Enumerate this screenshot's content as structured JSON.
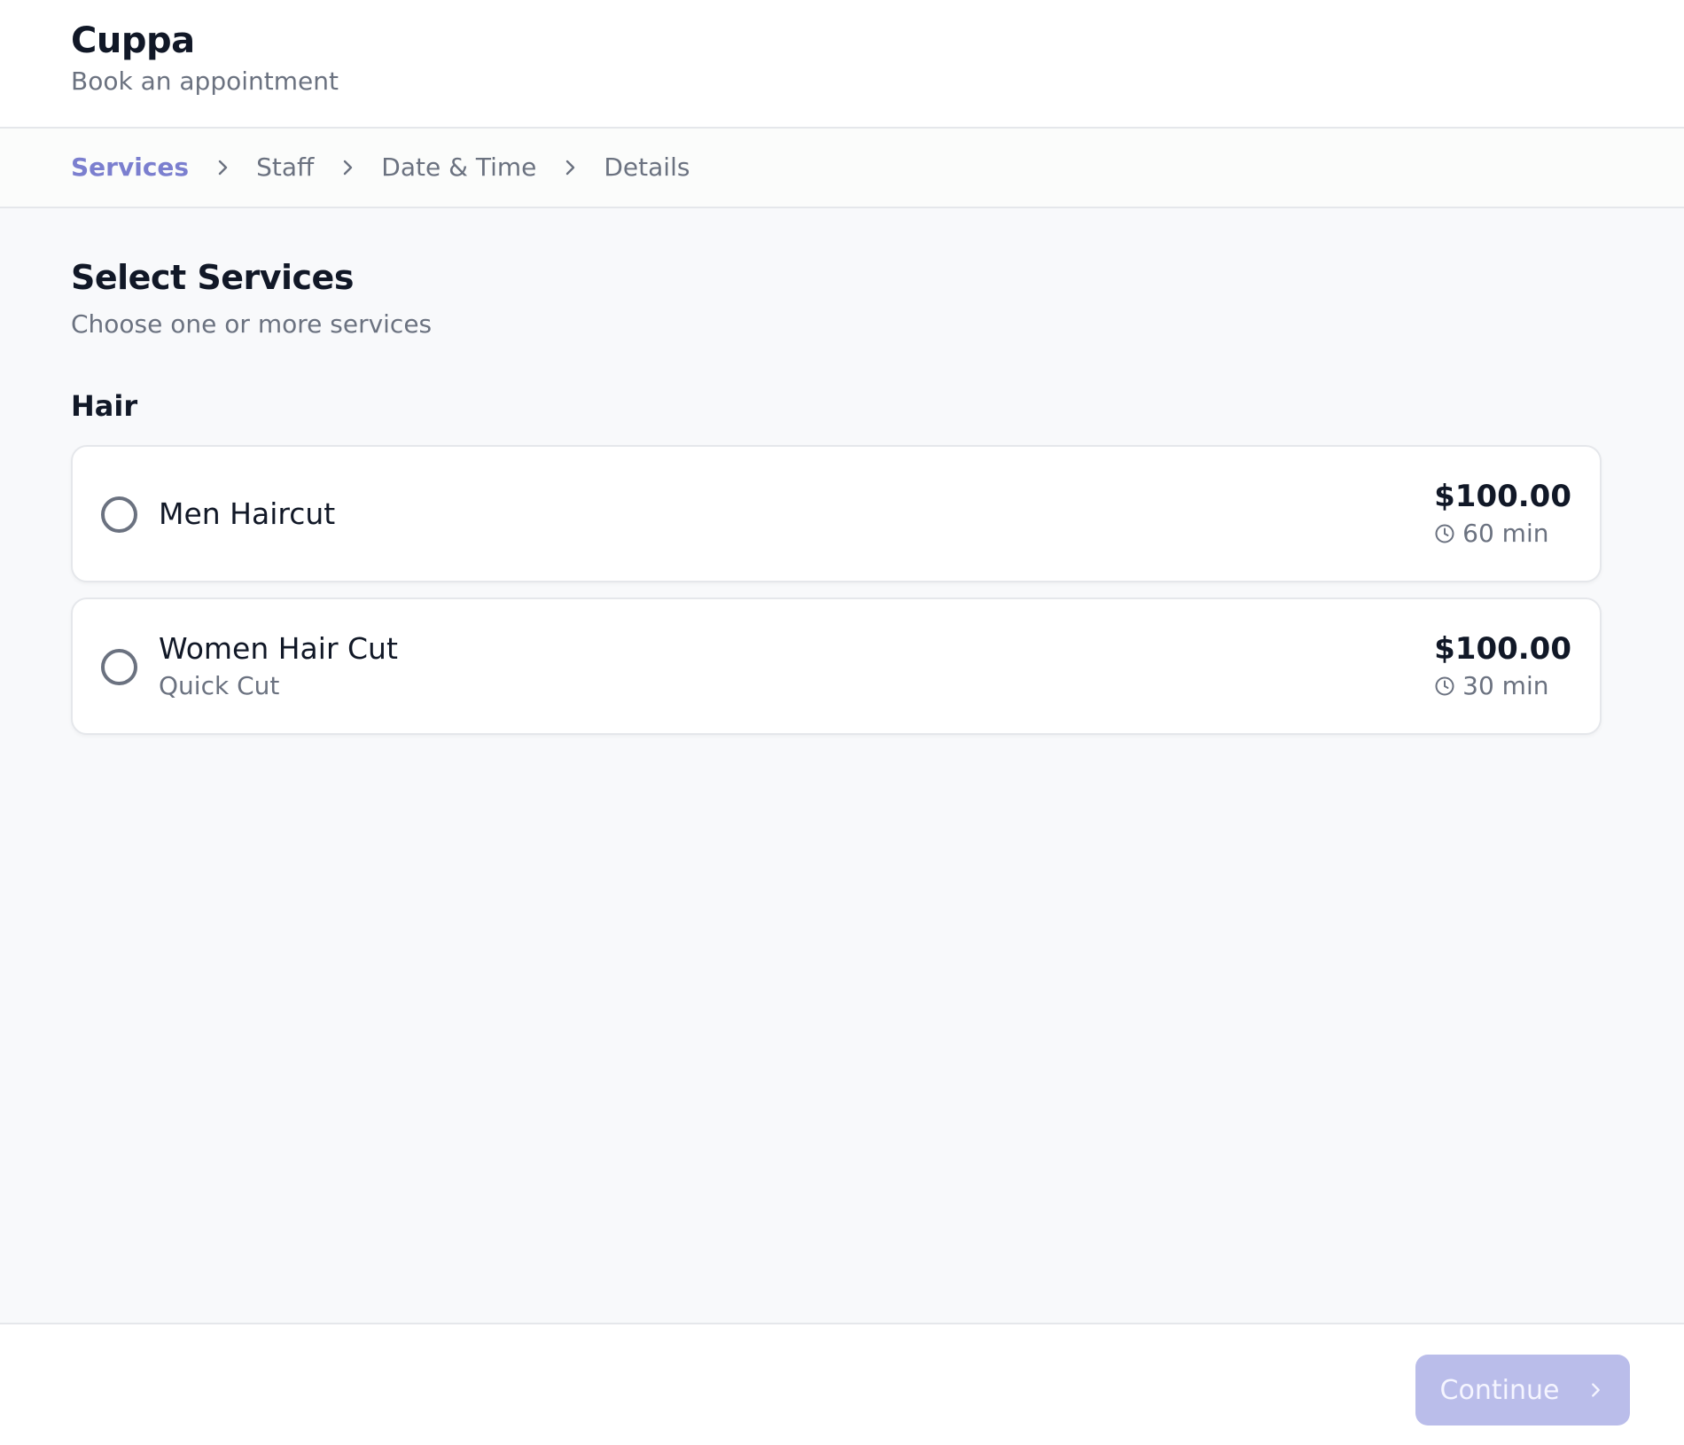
{
  "header": {
    "brand": "Cuppa",
    "tagline": "Book an appointment"
  },
  "stepper": {
    "steps": [
      {
        "label": "Services",
        "active": true
      },
      {
        "label": "Staff",
        "active": false
      },
      {
        "label": "Date & Time",
        "active": false
      },
      {
        "label": "Details",
        "active": false
      }
    ]
  },
  "main": {
    "title": "Select Services",
    "subtitle": "Choose one or more services",
    "categories": [
      {
        "name": "Hair",
        "services": [
          {
            "name": "Men Haircut",
            "description": "",
            "price": "$100.00",
            "duration": "60 min",
            "selected": false
          },
          {
            "name": "Women Hair Cut",
            "description": "Quick Cut",
            "price": "$100.00",
            "duration": "30 min",
            "selected": false
          }
        ]
      }
    ]
  },
  "footer": {
    "continue_label": "Continue",
    "continue_enabled": false
  },
  "colors": {
    "accent": "#7b7fcf",
    "button_disabled": "#babdea",
    "muted_text": "#6b7280"
  },
  "icons": {
    "step_separator": "chevron-right-icon",
    "duration": "clock-icon",
    "continue": "chevron-right-icon"
  }
}
